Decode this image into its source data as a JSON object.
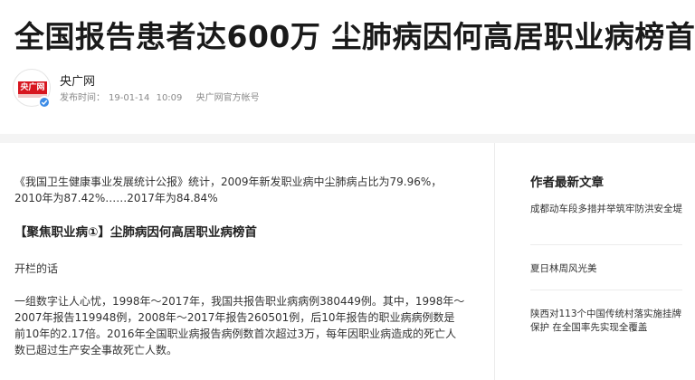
{
  "article": {
    "headline": "全国报告患者达600万 尘肺病因何高居职业病榜首",
    "author": {
      "name": "央广网",
      "logo_text": "央广网",
      "publish_label": "发布时间：",
      "date": "19-01-14",
      "time": "10:09",
      "account": "央广网官方帐号"
    },
    "paragraph1": "《我国卫生健康事业发展统计公报》统计，2009年新发职业病中尘肺病占比为79.96%，2010年为87.42%……2017年为84.84%",
    "section_heading": "【聚焦职业病①】尘肺病因何高居职业病榜首",
    "paragraph2": "开栏的话",
    "paragraph3": "一组数字让人心忧，1998年～2017年，我国共报告职业病病例380449例。其中，1998年～2007年报告119948例，2008年～2017年报告260501例，后10年报告的职业病病例数是前10年的2.17倍。2016年全国职业病报告病例数首次超过3万，每年因职业病造成的死亡人数已超过生产安全事故死亡人数。"
  },
  "sidebar": {
    "title": "作者最新文章",
    "items": [
      {
        "title": "成都动车段多措并举筑牢防洪安全堤"
      },
      {
        "title": "夏日林周风光美"
      },
      {
        "title": "陕西对113个中国传统村落实施挂牌保护 在全国率先实现全覆盖"
      }
    ]
  },
  "icons": {
    "verified": "verified-badge-icon"
  },
  "colors": {
    "brand_red": "#d7161f",
    "verified_blue": "#3c8ce7",
    "meta_gray": "#8a8a8a"
  }
}
